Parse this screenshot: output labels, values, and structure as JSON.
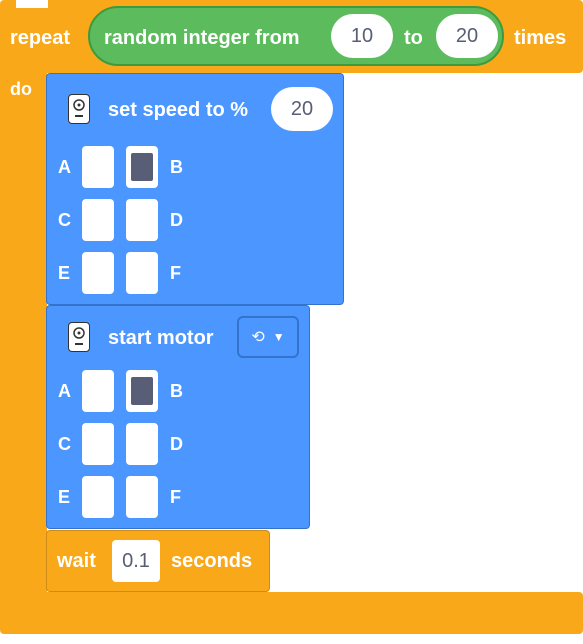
{
  "repeat": {
    "label": "repeat",
    "times_label": "times",
    "do_label": "do",
    "random": {
      "label": "random integer from",
      "from": "10",
      "to_label": "to",
      "to": "20"
    }
  },
  "set_speed": {
    "label": "set speed to %",
    "value": "20",
    "ports": [
      "A",
      "B",
      "C",
      "D",
      "E",
      "F"
    ],
    "selected": "B"
  },
  "start_motor": {
    "label": "start motor",
    "direction_symbol": "⟲",
    "dropdown_arrow": "▼",
    "ports": [
      "A",
      "B",
      "C",
      "D",
      "E",
      "F"
    ],
    "selected": "B"
  },
  "wait": {
    "label": "wait",
    "value": "0.1",
    "unit": "seconds"
  },
  "colors": {
    "control_orange": "#f9a81a",
    "operator_green": "#5cbb5c",
    "motor_blue": "#4c97ff",
    "text_dark": "#575e75"
  },
  "icons": {
    "motor": "motor-icon",
    "dropdown": "chevron-down-icon",
    "rotate": "rotate-ccw-icon"
  }
}
